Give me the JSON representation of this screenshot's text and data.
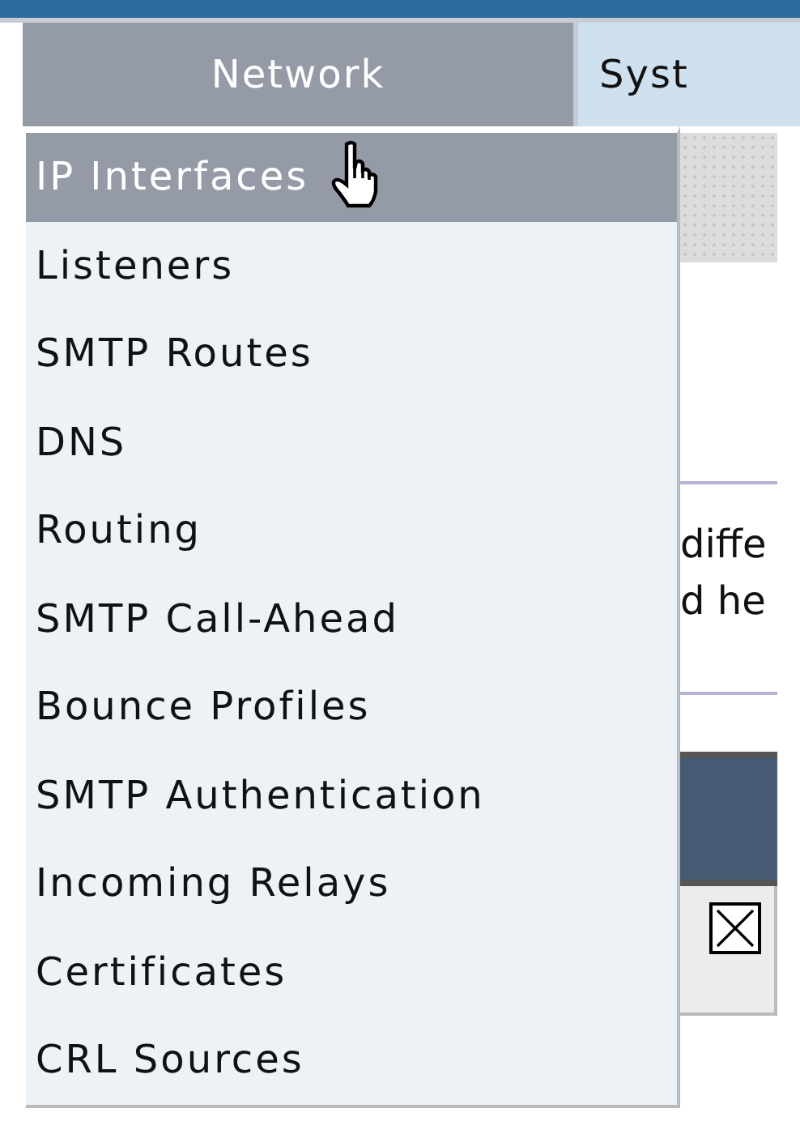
{
  "top_tabs": [
    {
      "label": "Network",
      "selected": true
    },
    {
      "label": "Syst",
      "selected": false
    }
  ],
  "dropdown_menu": {
    "items": [
      {
        "label": "IP Interfaces",
        "selected": true
      },
      {
        "label": "Listeners",
        "selected": false
      },
      {
        "label": "SMTP Routes",
        "selected": false
      },
      {
        "label": "DNS",
        "selected": false
      },
      {
        "label": "Routing",
        "selected": false
      },
      {
        "label": "SMTP Call-Ahead",
        "selected": false
      },
      {
        "label": "Bounce Profiles",
        "selected": false
      },
      {
        "label": "SMTP Authentication",
        "selected": false
      },
      {
        "label": "Incoming Relays",
        "selected": false
      },
      {
        "label": "Certificates",
        "selected": false
      },
      {
        "label": "CRL Sources",
        "selected": false
      }
    ]
  },
  "background_page": {
    "text_lines": [
      "diffe",
      "d he"
    ],
    "table_checkbox": {
      "checked": true
    }
  }
}
